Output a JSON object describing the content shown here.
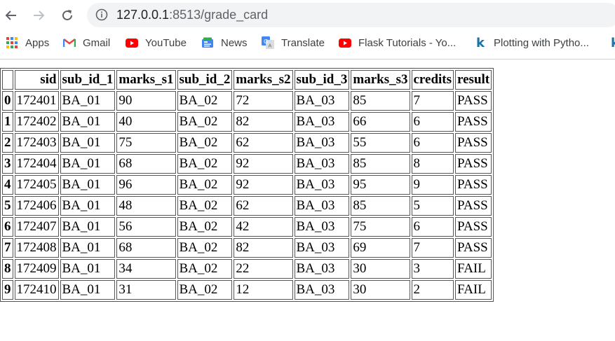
{
  "browser": {
    "url_host": "127.0.0.1",
    "url_path": ":8513/grade_card"
  },
  "bookmarks": [
    {
      "label": "Apps",
      "icon": "apps-grid-icon"
    },
    {
      "label": "Gmail",
      "icon": "gmail-icon"
    },
    {
      "label": "YouTube",
      "icon": "youtube-icon"
    },
    {
      "label": "News",
      "icon": "news-icon"
    },
    {
      "label": "Translate",
      "icon": "translate-icon"
    },
    {
      "label": "Flask Tutorials - Yo...",
      "icon": "youtube-icon"
    },
    {
      "label": "Plotting with Pytho...",
      "icon": "k-icon"
    }
  ],
  "table": {
    "columns": [
      "",
      "sid",
      "sub_id_1",
      "marks_s1",
      "sub_id_2",
      "marks_s2",
      "sub_id_3",
      "marks_s3",
      "credits",
      "result"
    ],
    "rows": [
      [
        "0",
        "172401",
        "BA_01",
        "90",
        "BA_02",
        "72",
        "BA_03",
        "85",
        "7",
        "PASS"
      ],
      [
        "1",
        "172402",
        "BA_01",
        "40",
        "BA_02",
        "82",
        "BA_03",
        "66",
        "6",
        "PASS"
      ],
      [
        "2",
        "172403",
        "BA_01",
        "75",
        "BA_02",
        "62",
        "BA_03",
        "55",
        "6",
        "PASS"
      ],
      [
        "3",
        "172404",
        "BA_01",
        "68",
        "BA_02",
        "92",
        "BA_03",
        "85",
        "8",
        "PASS"
      ],
      [
        "4",
        "172405",
        "BA_01",
        "96",
        "BA_02",
        "92",
        "BA_03",
        "95",
        "9",
        "PASS"
      ],
      [
        "5",
        "172406",
        "BA_01",
        "48",
        "BA_02",
        "62",
        "BA_03",
        "85",
        "5",
        "PASS"
      ],
      [
        "6",
        "172407",
        "BA_01",
        "56",
        "BA_02",
        "42",
        "BA_03",
        "75",
        "6",
        "PASS"
      ],
      [
        "7",
        "172408",
        "BA_01",
        "68",
        "BA_02",
        "82",
        "BA_03",
        "69",
        "7",
        "PASS"
      ],
      [
        "8",
        "172409",
        "BA_01",
        "34",
        "BA_02",
        "22",
        "BA_03",
        "30",
        "3",
        "FAIL"
      ],
      [
        "9",
        "172410",
        "BA_01",
        "31",
        "BA_02",
        "12",
        "BA_03",
        "30",
        "2",
        "FAIL"
      ]
    ]
  }
}
